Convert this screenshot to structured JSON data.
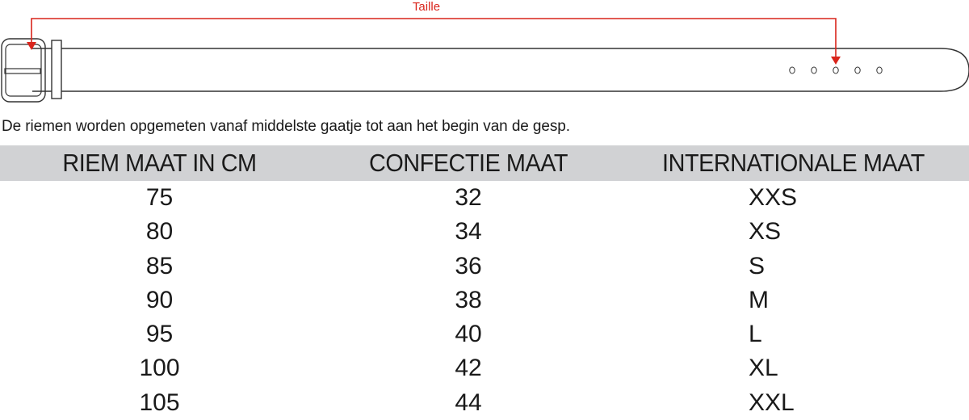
{
  "diagram": {
    "label": "Taille",
    "colors": {
      "arrow": "#d9251c",
      "outline": "#333333"
    }
  },
  "note": "De riemen worden opgemeten vanaf middelste gaatje tot aan het begin van de gesp.",
  "table": {
    "headers": [
      "RIEM MAAT IN CM",
      "CONFECTIE MAAT",
      "INTERNATIONALE MAAT"
    ],
    "header_bg": "#d1d2d4",
    "rows": [
      [
        "75",
        "32",
        "XXS"
      ],
      [
        "80",
        "34",
        "XS"
      ],
      [
        "85",
        "36",
        "S"
      ],
      [
        "90",
        "38",
        "M"
      ],
      [
        "95",
        "40",
        "L"
      ],
      [
        "100",
        "42",
        "XL"
      ],
      [
        "105",
        "44",
        "XXL"
      ]
    ]
  }
}
